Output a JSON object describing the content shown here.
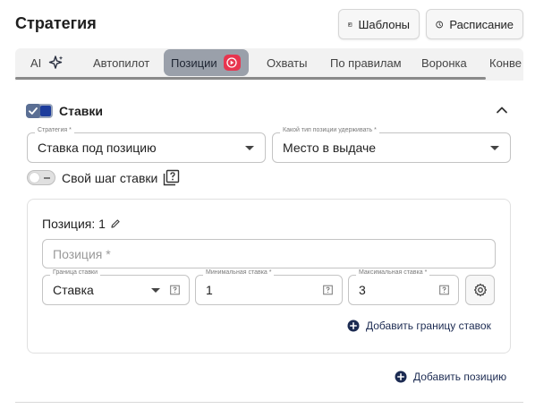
{
  "header": {
    "title": "Стратегия",
    "templates_label": "Шаблоны",
    "schedule_label": "Расписание"
  },
  "tabs": [
    {
      "label": "AI",
      "icon": "sparkles-icon"
    },
    {
      "label": "Автопилот"
    },
    {
      "label": "Позиции",
      "icon": "youtube-play-icon",
      "active": true
    },
    {
      "label": "Охваты"
    },
    {
      "label": "По правилам"
    },
    {
      "label": "Воронка"
    },
    {
      "label": "Конве"
    }
  ],
  "section": {
    "title": "Ставки",
    "checked": true,
    "strategy": {
      "label": "Стратегия *",
      "value": "Ставка под позицию"
    },
    "hold_type": {
      "label": "Какой тип позиции удерживать *",
      "value": "Место в выдаче"
    },
    "own_step": {
      "label": "Свой шаг ставки",
      "enabled": false
    }
  },
  "position_card": {
    "title": "Позиция: 1",
    "position_placeholder": "Позиция *",
    "border": {
      "label": "Граница ставки",
      "value": "Ставка"
    },
    "min_bid": {
      "label": "Минимальная ставка *",
      "value": "1"
    },
    "max_bid": {
      "label": "Максимальная ставка *",
      "value": "3"
    },
    "add_border_label": "Добавить границу ставок"
  },
  "add_position_label": "Добавить позицию",
  "colors": {
    "accent": "#1c3c9c",
    "active_tab": "#9aa0aa",
    "youtube_red": "#e8354f",
    "link": "#1c2b52"
  }
}
